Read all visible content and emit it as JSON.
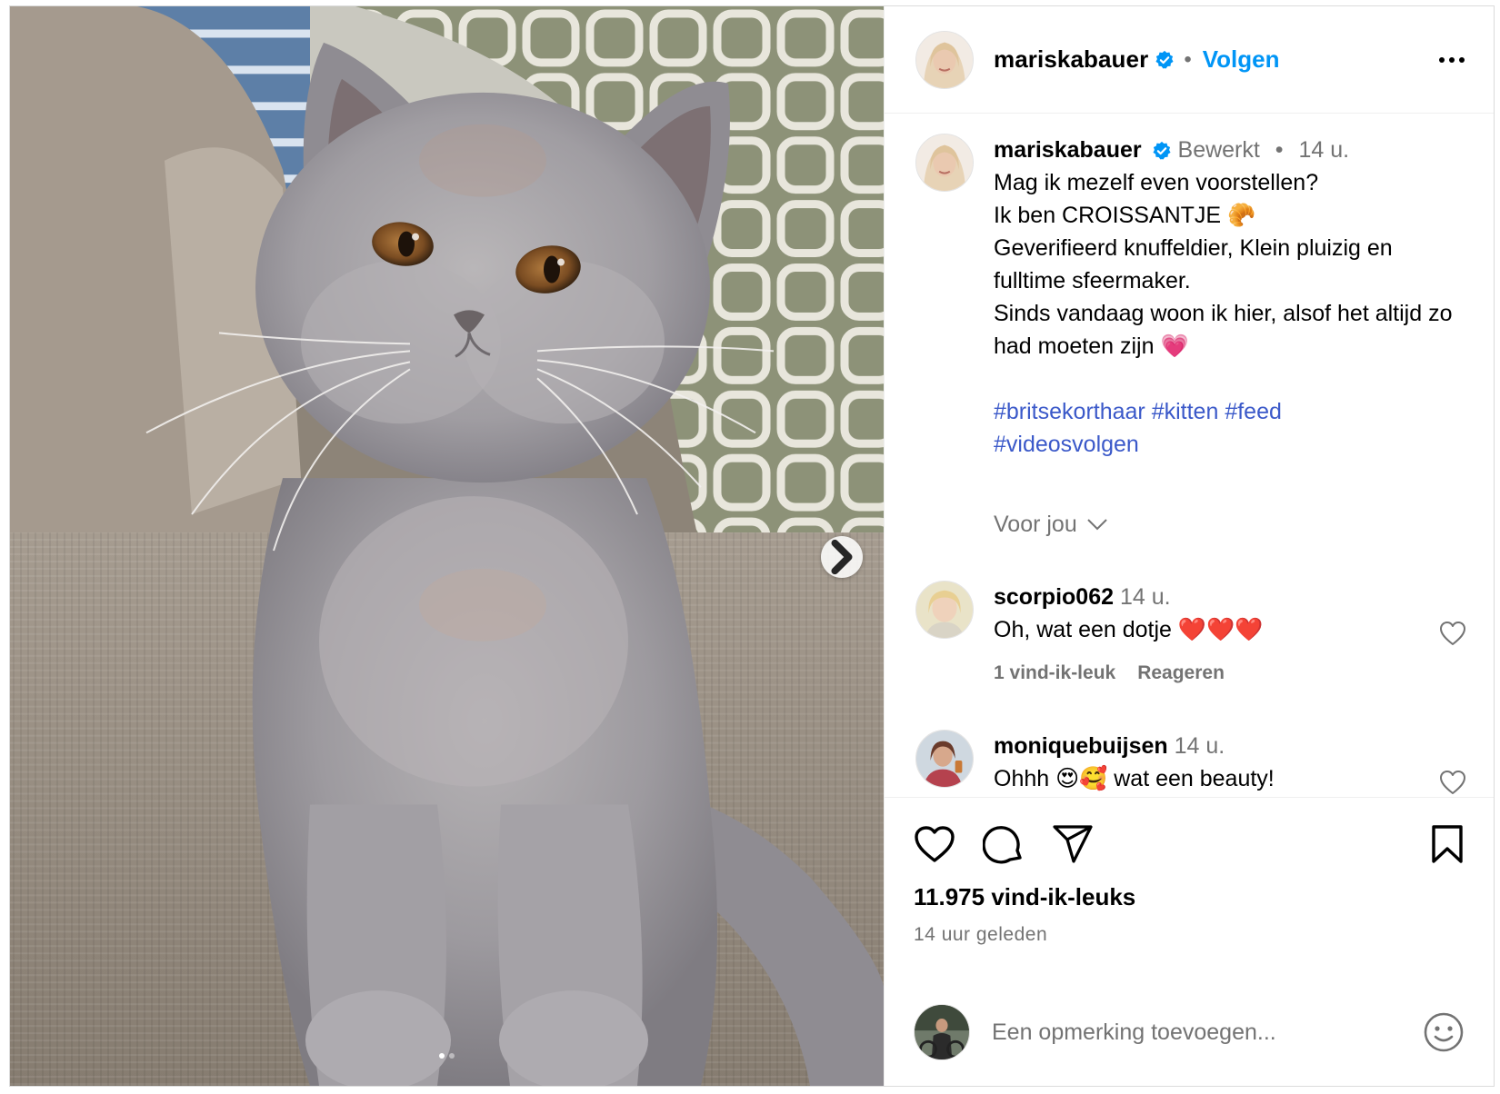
{
  "post": {
    "username": "mariskabauer",
    "follow_label": "Volgen",
    "dot_separator": "•",
    "caption": {
      "meta_edited": "Bewerkt",
      "meta_sep": "•",
      "meta_time": "14 u.",
      "text": "Mag ik mezelf even voorstellen?\nIk ben CROISSANTJE 🥐\nGeverifieerd knuffeldier, Klein pluizig en fulltime sfeermaker.\nSinds vandaag woon ik hier, alsof het altijd zo had moeten zijn 💗",
      "hashtags": [
        "#britsekorthaar",
        "#kitten",
        "#feed",
        "#videosvolgen"
      ]
    },
    "translate_label": "Voor jou",
    "comments": [
      {
        "username": "scorpio062",
        "time": "14 u.",
        "text": "Oh, wat een dotje ❤️❤️❤️",
        "likes_label": "1 vind-ik-leuk",
        "reply_label": "Reageren"
      },
      {
        "username": "moniquebuijsen",
        "time": "14 u.",
        "text": "Ohhh 😍🥰 wat een beauty!"
      }
    ],
    "likes_count": "11.975 vind-ik-leuks",
    "posted_ago": "14 uur geleden",
    "comment_placeholder": "Een opmerking toevoegen...",
    "carousel": {
      "total_images": 2,
      "current_index": 1
    }
  },
  "colors": {
    "accent_blue": "#0095f6",
    "hashtag_blue": "#3b59c9",
    "verified_blue": "#0095f6",
    "muted_text": "#737373",
    "border": "#efefef"
  },
  "icons": {
    "verified": "verified-badge-icon",
    "more": "more-options-icon",
    "next": "chevron-right-icon",
    "like": "heart-icon",
    "comment": "comment-bubble-icon",
    "share": "paper-plane-icon",
    "save": "bookmark-icon",
    "emoji": "smiley-icon",
    "expand": "chevron-down-icon"
  }
}
